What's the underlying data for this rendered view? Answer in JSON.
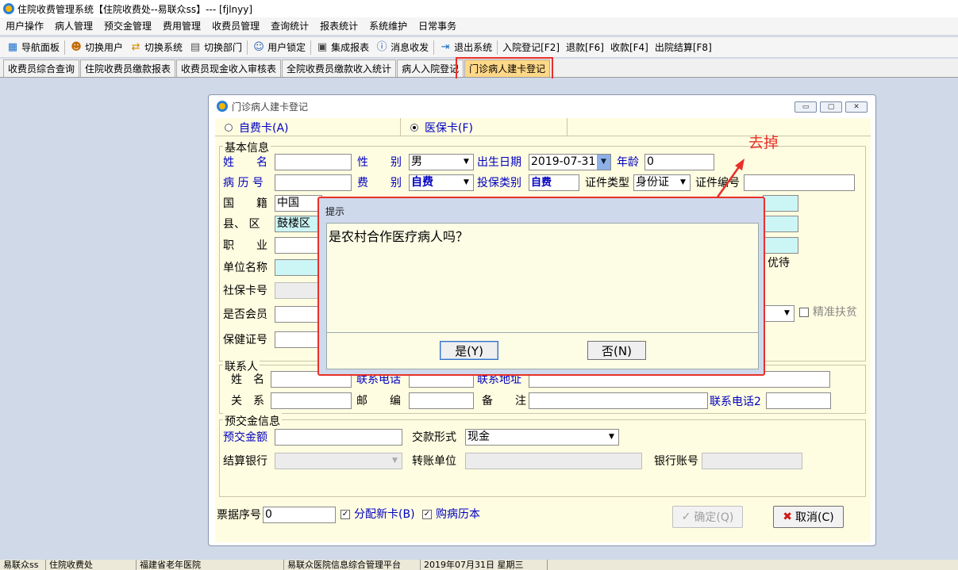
{
  "window": {
    "title": "住院收费管理系统【住院收费处--易联众ss】--- [fjlnyy]"
  },
  "menu": [
    "用户操作",
    "病人管理",
    "预交金管理",
    "费用管理",
    "收费员管理",
    "查询统计",
    "报表统计",
    "系统维护",
    "日常事务"
  ],
  "toolbar": {
    "nav": "导航面板",
    "switch_user": "切换用户",
    "switch_system": "切换系统",
    "switch_dept": "切换部门",
    "lock_user": "用户锁定",
    "report": "集成报表",
    "message": "消息收发",
    "exit": "退出系统",
    "admission": "入院登记[F2]",
    "refund": "退款[F6]",
    "payment": "收款[F4]",
    "discharge": "出院结算[F8]"
  },
  "tabs": [
    "收费员综合查询",
    "住院收费员缴款报表",
    "收费员现金收入审核表",
    "全院收费员缴款收入统计",
    "病人入院登记",
    "门诊病人建卡登记"
  ],
  "child": {
    "title": "门诊病人建卡登记",
    "radio_self": "自费卡(A)",
    "radio_insurance": "医保卡(F)",
    "basic_info": "基本信息",
    "labels": {
      "name": "姓　　名",
      "gender": "性　　别",
      "birth": "出生日期",
      "age": "年龄",
      "record_no": "病 历 号",
      "fee_type": "费　　别",
      "insure_type": "投保类别",
      "cert_type": "证件类型",
      "cert_no": "证件编号",
      "nation": "国　　籍",
      "county": "县、 区",
      "job": "职　　业",
      "unit": "单位名称",
      "social_card": "社保卡号",
      "member": "是否会员",
      "health_card": "保健证号",
      "priority": "优待",
      "poverty": "精准扶贫"
    },
    "values": {
      "gender": "男",
      "birth": "2019-07-31",
      "age": "0",
      "fee_type": "自费",
      "insure_type": "自费",
      "cert_type": "身份证",
      "nation": "中国",
      "county": "鼓楼区"
    },
    "contact": {
      "title": "联系人",
      "name": "姓　名",
      "phone": "联系电话",
      "address": "联系地址",
      "relation": "关　系",
      "postcode": "邮　　编",
      "remark": "备　　注",
      "phone2": "联系电话2"
    },
    "deposit": {
      "title": "预交金信息",
      "amount": "预交金额",
      "pay_form": "交款形式",
      "pay_form_value": "现金",
      "bank": "结算银行",
      "transfer_unit": "转账单位",
      "bank_account": "银行账号"
    },
    "footer": {
      "receipt_no": "票据序号",
      "receipt_value": "0",
      "assign_card": "分配新卡(B)",
      "buy_book": "购病历本",
      "ok": "确定(Q)",
      "cancel": "取消(C)"
    }
  },
  "annotation": "去掉",
  "dialog": {
    "title": "提示",
    "message": "是农村合作医疗病人吗？",
    "yes": "是(Y)",
    "no": "否(N)"
  },
  "statusbar": [
    "易联众ss",
    "住院收费处",
    "福建省老年医院",
    "易联众医院信息综合管理平台",
    "2019年07月31日 星期三"
  ],
  "colors": {
    "accent_red": "#e8302a",
    "label_blue": "#0000c0",
    "form_bg": "#fffde1"
  }
}
